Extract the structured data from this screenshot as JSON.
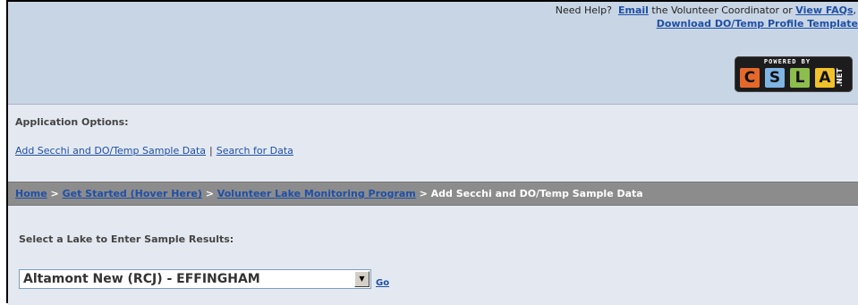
{
  "header": {
    "help_prefix": "Need Help?",
    "email_link": "Email",
    "help_middle": "the Volunteer Coordinator or",
    "faq_link": "View FAQs",
    "help_suffix": ",",
    "template_link": "Download DO/Temp Profile Template",
    "badge": {
      "powered_by": "POWERED BY",
      "letters": [
        "C",
        "S",
        "L",
        "A"
      ],
      "suffix": ".NET"
    }
  },
  "options": {
    "title": "Application Options:",
    "links": [
      "Add Secchi and DO/Temp Sample Data",
      "Search for Data"
    ],
    "separator": "|"
  },
  "breadcrumb": {
    "items": [
      "Home",
      "Get Started (Hover Here)",
      "Volunteer Lake Monitoring Program"
    ],
    "separator": ">",
    "current": "Add Secchi and DO/Temp Sample Data"
  },
  "form": {
    "label": "Select a Lake to Enter Sample Results:",
    "selected_lake": "Altamont New (RCJ) - EFFINGHAM",
    "go_label": "Go"
  },
  "colors": {
    "header_bg": "#c8d5e5",
    "page_bg": "#e4e9f1",
    "breadcrumb_bg": "#8c8c8c",
    "link": "#1f4fa6"
  }
}
